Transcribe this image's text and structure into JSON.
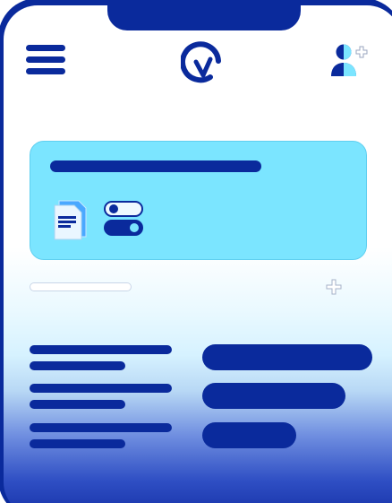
{
  "header": {
    "menu_icon": "hamburger-menu-icon",
    "logo_icon": "q-checkmark-logo-icon",
    "profile_icon": "add-user-icon"
  },
  "card": {
    "background": "#7be5ff",
    "document_icon": "document-icon",
    "toggles": [
      {
        "state": "off"
      },
      {
        "state": "on"
      }
    ]
  },
  "search": {
    "add_icon": "plus-icon"
  },
  "rows": [
    {
      "lines": 2,
      "button": "wide"
    },
    {
      "lines": 2,
      "button": "medium"
    },
    {
      "lines": 2,
      "button": "short"
    }
  ],
  "colors": {
    "primary": "#0a2a9c",
    "accent": "#7be5ff",
    "frame": "#0a2a9c"
  }
}
